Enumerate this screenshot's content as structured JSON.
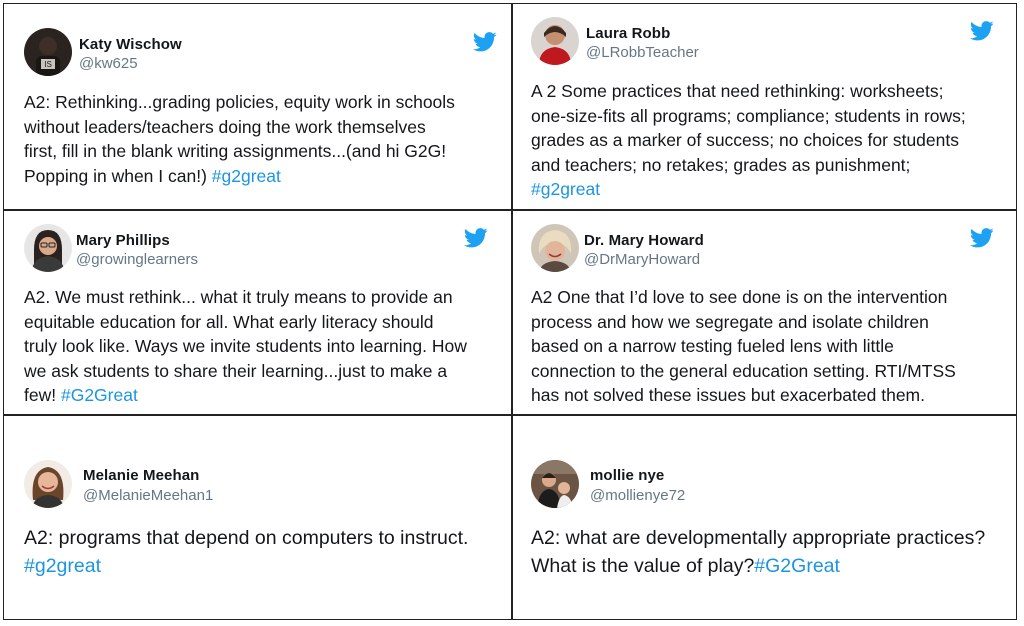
{
  "colors": {
    "hashtag": "#1b95e0",
    "handle": "#657786",
    "twitter_blue": "#1da1f2"
  },
  "tweets": [
    {
      "name": "Katy Wischow",
      "handle": "@kw625",
      "lines": [
        "A2: Rethinking...grading policies, equity work in schools",
        "without leaders/teachers doing the work themselves",
        "first, fill in the blank writing assignments...(and hi G2G!",
        "Popping in when I can!) "
      ],
      "hashtag": "#g2great"
    },
    {
      "name": "Laura Robb",
      "handle": "@LRobbTeacher",
      "lines": [
        "A 2 Some practices that need rethinking: worksheets;",
        "one-size-fits all programs; compliance; students in rows;",
        "grades as a marker of success; no choices for students",
        "and teachers;  no retakes; grades as punishment;"
      ],
      "hashtag": "#g2great"
    },
    {
      "name": "Mary Phillips",
      "handle": "@growinglearners",
      "lines": [
        "A2. We must rethink... what it truly means to provide an",
        "equitable education for all. What early literacy should",
        "truly look like. Ways we invite students into learning. How",
        "we ask students to share their learning...just to make a",
        "few! "
      ],
      "hashtag": "#G2Great"
    },
    {
      "name": "Dr. Mary Howard",
      "handle": "@DrMaryHoward",
      "lines": [
        "A2 One that I’d love to see done is on the intervention",
        "process and how we segregate and isolate children",
        "based on a narrow testing fueled lens with little",
        "connection to the general education setting.  RTI/MTSS",
        "has not solved these issues but exacerbated them."
      ],
      "hashtag": ""
    },
    {
      "name": "Melanie Meehan",
      "handle": "@MelanieMeehan1",
      "lines": [
        "A2: programs that depend on computers to instruct."
      ],
      "hashtag": "#g2great"
    },
    {
      "name": "mollie nye",
      "handle": "@mollienye72",
      "lines": [
        "A2: what are developmentally appropriate practices?",
        "What is the value of play?"
      ],
      "hashtag": "#G2Great"
    }
  ]
}
